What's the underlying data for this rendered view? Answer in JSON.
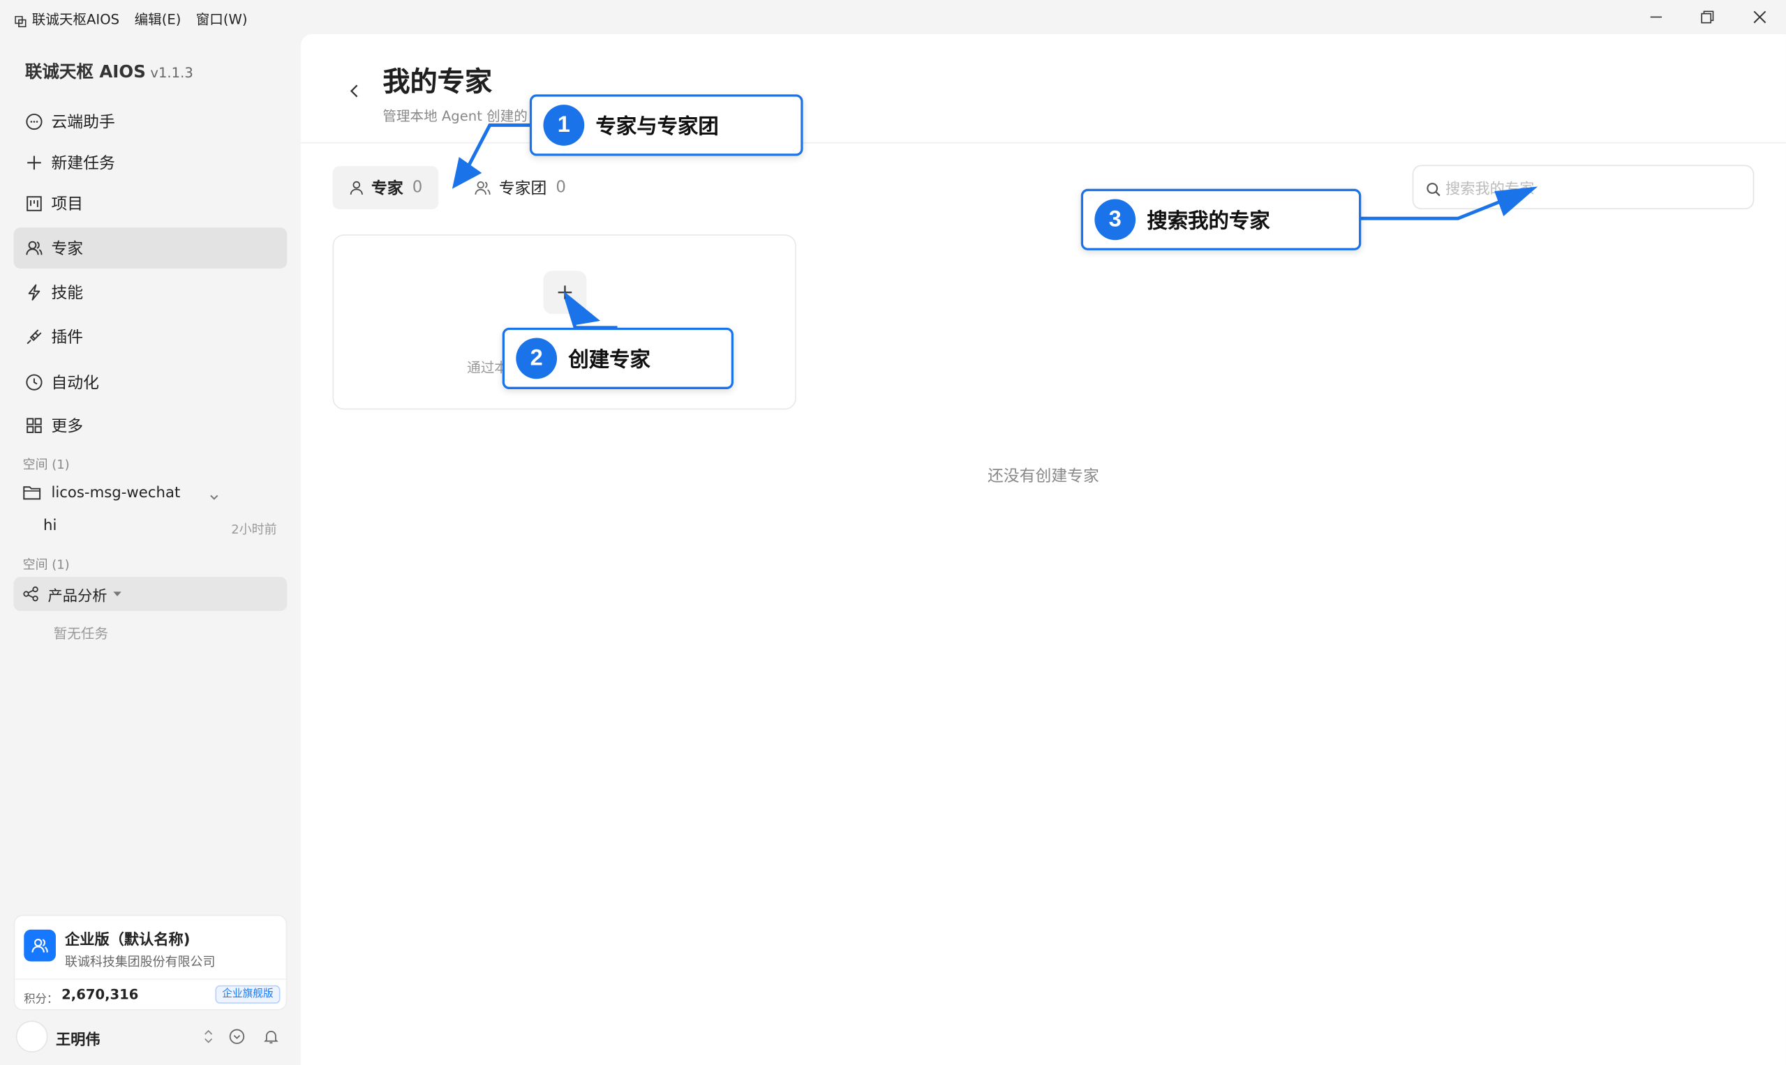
{
  "app": {
    "menu_title": "联诚天枢AIOS",
    "menu_edit": "编辑(E)",
    "menu_window": "窗口(W)"
  },
  "sidebar": {
    "brand": "联诚天枢 AIOS",
    "version": "v1.1.3",
    "nav": [
      {
        "label": "云端助手",
        "icon": "chat-bubble-icon"
      },
      {
        "label": "新建任务",
        "icon": "plus-icon"
      },
      {
        "label": "项目",
        "icon": "kanban-icon"
      },
      {
        "label": "专家",
        "icon": "experts-icon",
        "active": true
      },
      {
        "label": "技能",
        "icon": "lightning-icon"
      },
      {
        "label": "插件",
        "icon": "plug-icon"
      },
      {
        "label": "自动化",
        "icon": "clock-icon"
      },
      {
        "label": "更多",
        "icon": "grid-icon"
      }
    ],
    "space_section_1": "空间 (1)",
    "folder_name": "licos-msg-wechat",
    "task_name": "hi",
    "task_time": "2小时前",
    "space_section_2": "空间 (1)",
    "shared_space": "产品分析",
    "no_tasks": "暂无任务",
    "org": {
      "name": "企业版（默认名称)",
      "company": "联诚科技集团股份有限公司",
      "points_label": "积分：",
      "points_value": "2,670,316",
      "badge": "企业旗舰版"
    },
    "user_name": "王明伟"
  },
  "main": {
    "title": "我的专家",
    "subtitle": "管理本地 Agent 创建的",
    "tabs": [
      {
        "label": "专家",
        "count": "0",
        "active": true
      },
      {
        "label": "专家团",
        "count": "0",
        "active": false
      }
    ],
    "search_placeholder": "搜索我的专家",
    "card_desc": "通过本",
    "empty_text": "还没有创建专家"
  },
  "annotations": [
    {
      "number": "1",
      "text": "专家与专家团"
    },
    {
      "number": "2",
      "text": "创建专家"
    },
    {
      "number": "3",
      "text": "搜索我的专家"
    }
  ],
  "colors": {
    "accent": "#1a73e8",
    "brand_blue": "#1677ff",
    "sidebar_bg": "#f4f4f4"
  }
}
